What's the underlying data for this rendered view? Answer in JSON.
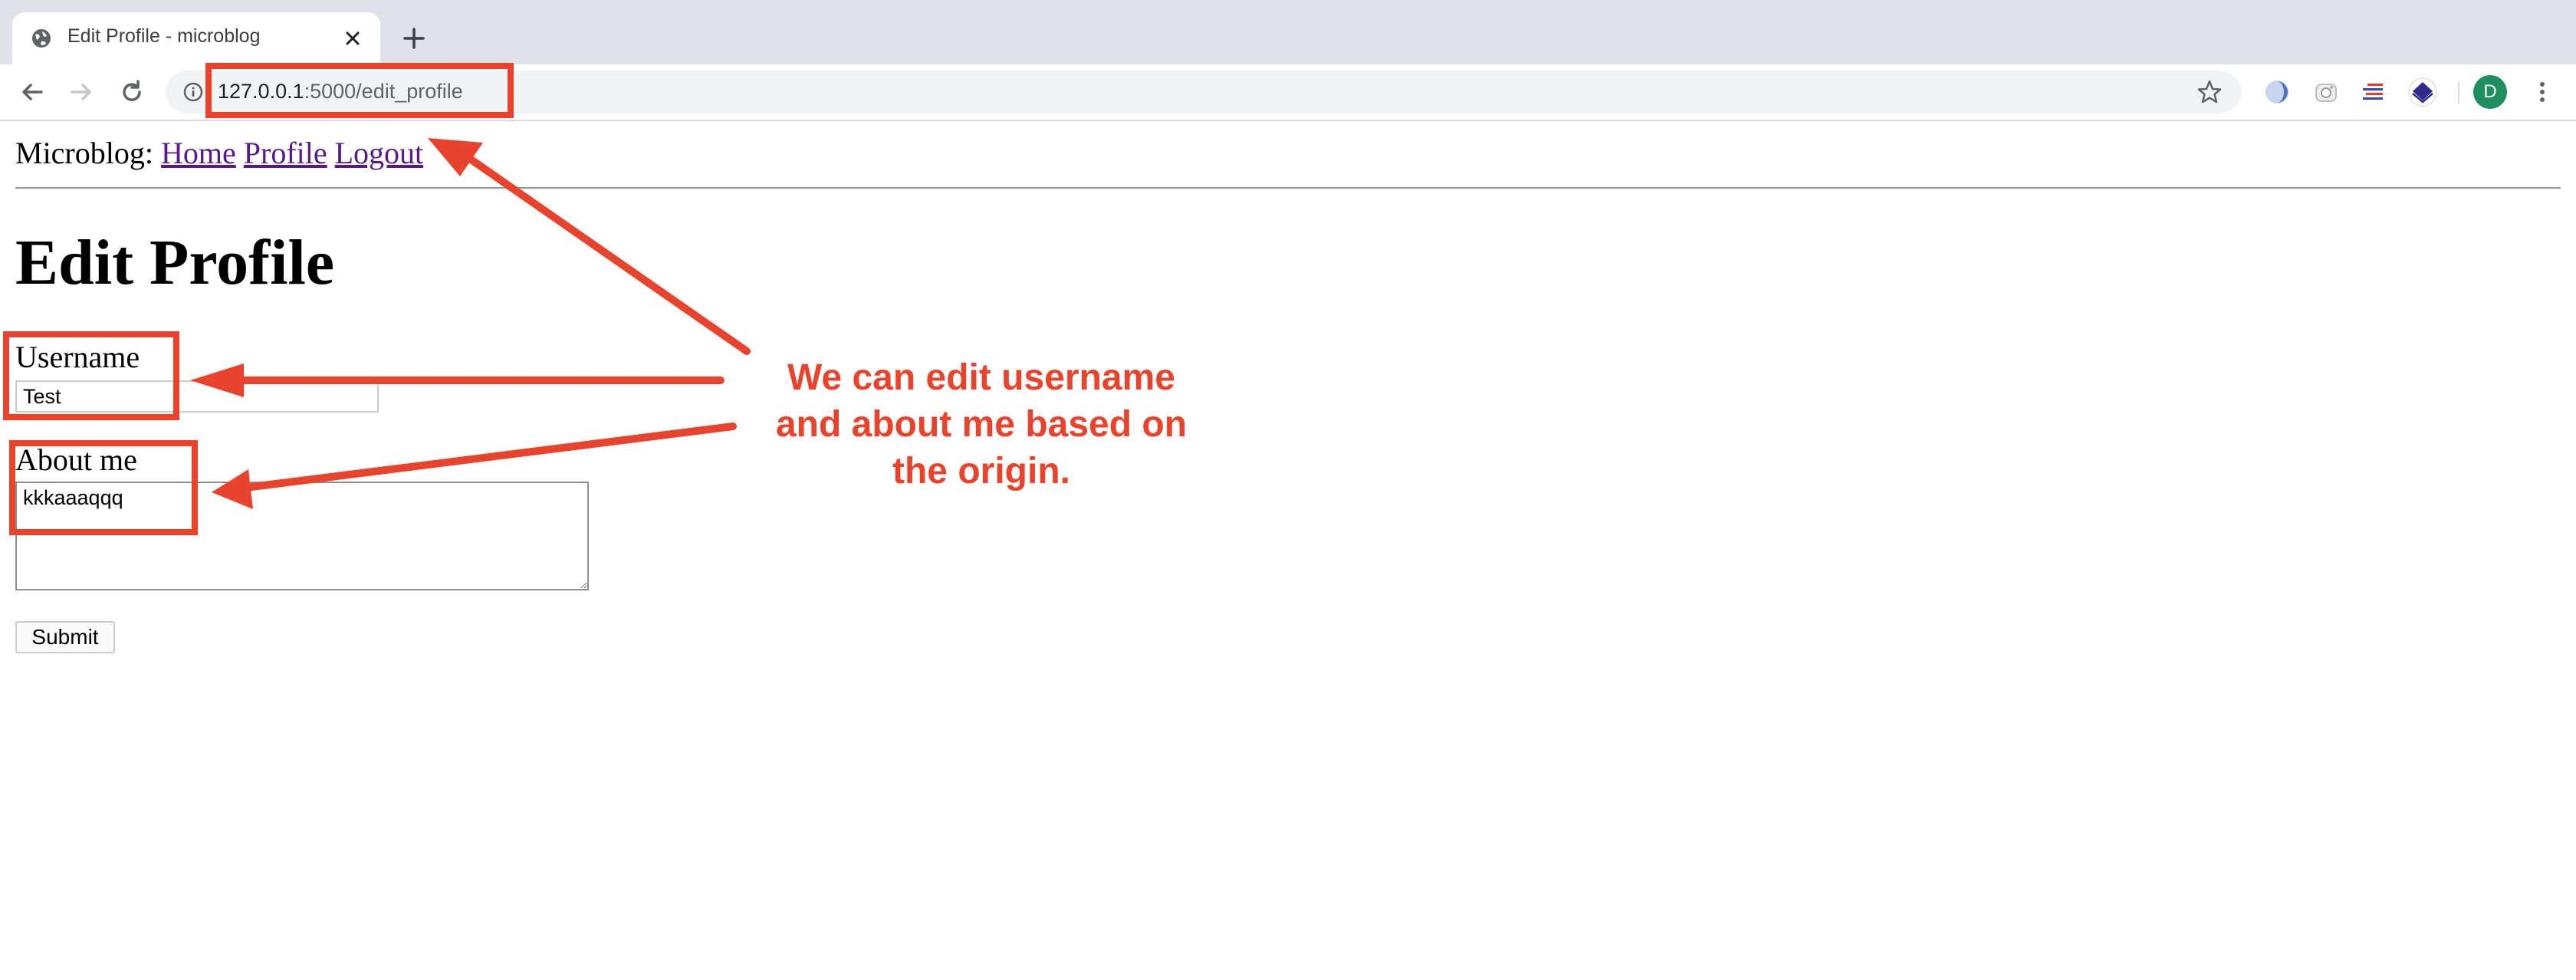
{
  "browser": {
    "tab_title": "Edit Profile - microblog",
    "url_host": "127.0.0.1",
    "url_path": ":5000/edit_profile",
    "avatar_letter": "D"
  },
  "page": {
    "brand": "Microblog:",
    "nav": {
      "home": "Home",
      "profile": "Profile",
      "logout": "Logout"
    },
    "heading": "Edit Profile",
    "username_label": "Username",
    "username_value": "Test",
    "about_label": "About me",
    "about_value": "kkkaaaqqq",
    "submit_label": "Submit"
  },
  "annotation": {
    "color": "#e8442d",
    "line1": "We can edit username",
    "line2": "and about me based on",
    "line3": "the origin."
  }
}
